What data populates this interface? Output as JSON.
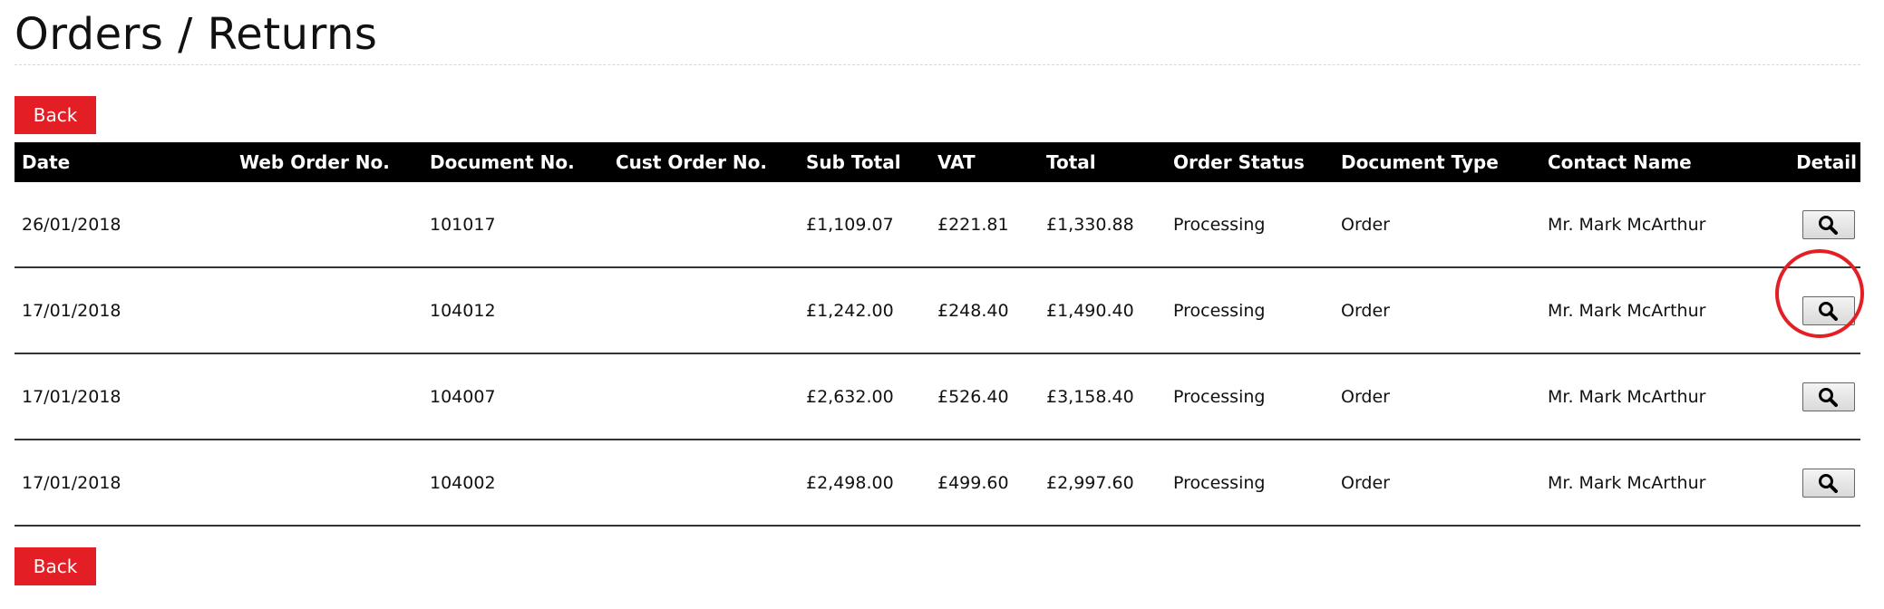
{
  "page": {
    "title": "Orders / Returns"
  },
  "buttons": {
    "back_top": "Back",
    "back_bottom": "Back"
  },
  "colors": {
    "accent": "#e31e24",
    "header_bg": "#000000",
    "header_text": "#ffffff"
  },
  "table": {
    "headers": {
      "date": "Date",
      "web_order_no": "Web Order No.",
      "document_no": "Document No.",
      "cust_order_no": "Cust Order No.",
      "sub_total": "Sub Total",
      "vat": "VAT",
      "total": "Total",
      "order_status": "Order Status",
      "document_type": "Document Type",
      "contact_name": "Contact Name",
      "detail": "Detail"
    },
    "rows": [
      {
        "date": "26/01/2018",
        "web_order_no": "",
        "document_no": "101017",
        "cust_order_no": "",
        "sub_total": "£1,109.07",
        "vat": "£221.81",
        "total": "£1,330.88",
        "order_status": "Processing",
        "document_type": "Order",
        "contact_name": "Mr. Mark McArthur",
        "detail_icon": "magnifier-icon"
      },
      {
        "date": "17/01/2018",
        "web_order_no": "",
        "document_no": "104012",
        "cust_order_no": "",
        "sub_total": "£1,242.00",
        "vat": "£248.40",
        "total": "£1,490.40",
        "order_status": "Processing",
        "document_type": "Order",
        "contact_name": "Mr. Mark McArthur",
        "detail_icon": "magnifier-icon"
      },
      {
        "date": "17/01/2018",
        "web_order_no": "",
        "document_no": "104007",
        "cust_order_no": "",
        "sub_total": "£2,632.00",
        "vat": "£526.40",
        "total": "£3,158.40",
        "order_status": "Processing",
        "document_type": "Order",
        "contact_name": "Mr. Mark McArthur",
        "detail_icon": "magnifier-icon"
      },
      {
        "date": "17/01/2018",
        "web_order_no": "",
        "document_no": "104002",
        "cust_order_no": "",
        "sub_total": "£2,498.00",
        "vat": "£499.60",
        "total": "£2,997.60",
        "order_status": "Processing",
        "document_type": "Order",
        "contact_name": "Mr. Mark McArthur",
        "detail_icon": "magnifier-icon"
      }
    ]
  }
}
